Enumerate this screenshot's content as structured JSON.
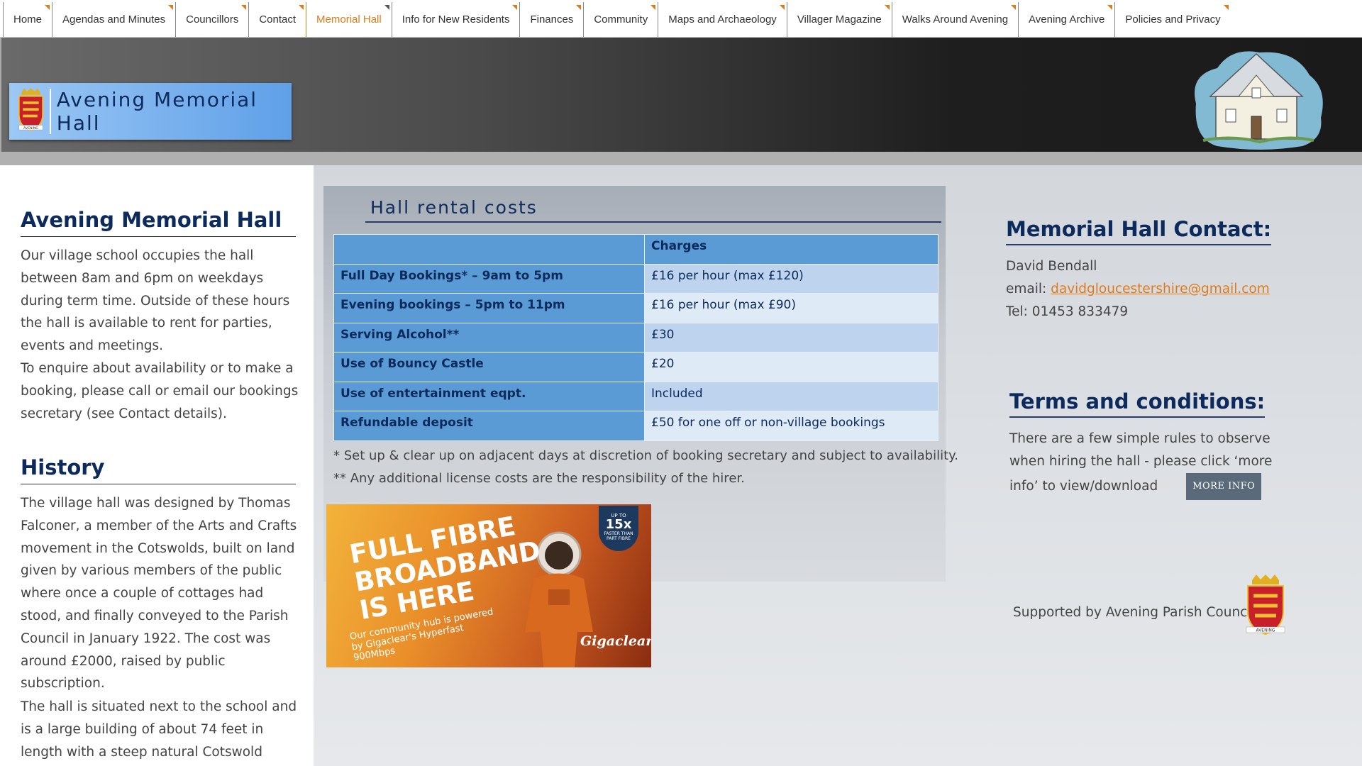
{
  "nav": {
    "items": [
      {
        "label": "Home"
      },
      {
        "label": "Agendas and Minutes"
      },
      {
        "label": "Councillors"
      },
      {
        "label": "Contact"
      },
      {
        "label": "Memorial Hall"
      },
      {
        "label": "Info for New Residents"
      },
      {
        "label": "Finances"
      },
      {
        "label": "Community"
      },
      {
        "label": "Maps and Archaeology"
      },
      {
        "label": "Villager Magazine"
      },
      {
        "label": "Walks Around Avening"
      },
      {
        "label": "Avening Archive"
      },
      {
        "label": "Policies and Privacy"
      }
    ],
    "active_index": 4,
    "active_color": "#e07b1a"
  },
  "header": {
    "title": "Avening Memorial Hall",
    "crest_label": "AVENING"
  },
  "left": {
    "intro_heading": "Avening Memorial Hall",
    "intro_text": "Our village school occupies the hall between 8am and 6pm on weekdays during term time. Outside of these hours the hall is available to rent for parties, events and meetings.",
    "intro_text2": "To enquire about availability or to make a booking, please call or email our bookings secretary (see Contact details).",
    "history_heading": "History",
    "history_text": "The village hall was designed by Thomas Falconer, a member of the Arts and Crafts movement in the Cotswolds, built on land given by various members of the public where once a couple of cottages had stood, and finally conveyed to the Parish Council in January 1922. The cost was around £2000, raised by public subscription.",
    "history_text2": "The hall is situated next to the school and is a large building of about 74 feet in length with a steep natural Cotswold stone tiled roof. Its"
  },
  "rental": {
    "heading": "Hall rental costs",
    "column_header": "Charges",
    "rows": [
      {
        "label": "Full Day Bookings* – 9am to 5pm",
        "value": "£16 per hour (max £120)"
      },
      {
        "label": "Evening bookings – 5pm to 11pm",
        "value": "£16 per hour (max £90)"
      },
      {
        "label": "Serving Alcohol**",
        "value": "£30"
      },
      {
        "label": "Use of Bouncy Castle",
        "value": "£20"
      },
      {
        "label": "Use of entertainment eqpt.",
        "value": "Included"
      },
      {
        "label": "Refundable deposit",
        "value": "£50 for one off or non-village bookings"
      }
    ],
    "footnote1": "* Set up & clear up on adjacent days at discretion of booking secretary and subject to availability.",
    "footnote2": "** Any additional license costs are the responsibility of the hirer."
  },
  "ad": {
    "line1": "FULL FIBRE",
    "line2": "BROADBAND",
    "line3": "IS HERE",
    "sub": "Our community hub is powered by Gigaclear's Hyperfast 900Mbps",
    "badge_top": "UP TO",
    "badge_main": "15x",
    "badge_mid": "FASTER THAN",
    "badge_bottom": "PART FIBRE",
    "brand": "Gigaclear"
  },
  "contact": {
    "heading": "Memorial Hall Contact:",
    "name": "David Bendall",
    "email_label": "email: ",
    "email": "davidgloucestershire@gmail.com",
    "tel": "Tel: 01453 833479"
  },
  "terms": {
    "heading": "Terms and conditions:",
    "text_line1": "There are a few simple rules to observe",
    "text_line2": "when hiring the hall - please click ‘more",
    "text_line3": "info’ to view/download",
    "button": "MORE INFO"
  },
  "support": {
    "text": "Supported by Avening Parish Council"
  },
  "colors": {
    "heading": "#0d2a5c",
    "table_header": "#5b9bd5",
    "link": "#e07b1a"
  }
}
